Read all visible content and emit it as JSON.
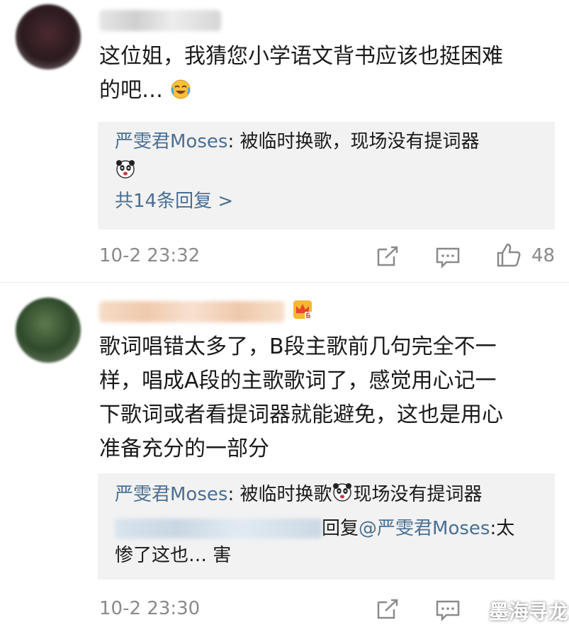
{
  "comments": [
    {
      "text_line1": "这位姐，我猜您小学语文背书应该也挺困难",
      "text_line2": "的吧…",
      "reply": {
        "author": "严雯君Moses",
        "text": ": 被临时换歌，现场没有提词器",
        "more": "共14条回复 >"
      },
      "time": "10-2 23:32",
      "likes": "48"
    },
    {
      "text_line1": "歌词唱错太多了，B段主歌前几句完全不一",
      "text_line2": "样，唱成A段的主歌歌词了，感觉用心记一",
      "text_line3": "下歌词或者看提词器就能避免，这也是用心",
      "text_line4": "准备充分的一部分",
      "reply": {
        "author": "严雯君Moses",
        "text_a": ": 被临时换歌",
        "text_b": "现场没有提词器",
        "reply_word": "回复",
        "mention": "@严雯君Moses",
        "text_c": ":太",
        "text_d": "惨了这也… 害"
      },
      "time": "10-2 23:30"
    }
  ],
  "watermark": "墨海寻龙",
  "colors": {
    "link": "#4a6f92",
    "meta": "#8a8a8a",
    "reply_bg": "#f2f2f2"
  },
  "icons": [
    "share-icon",
    "comment-icon",
    "like-icon",
    "crown-badge-icon",
    "laugh-cry-emoji",
    "panda-emoji"
  ]
}
